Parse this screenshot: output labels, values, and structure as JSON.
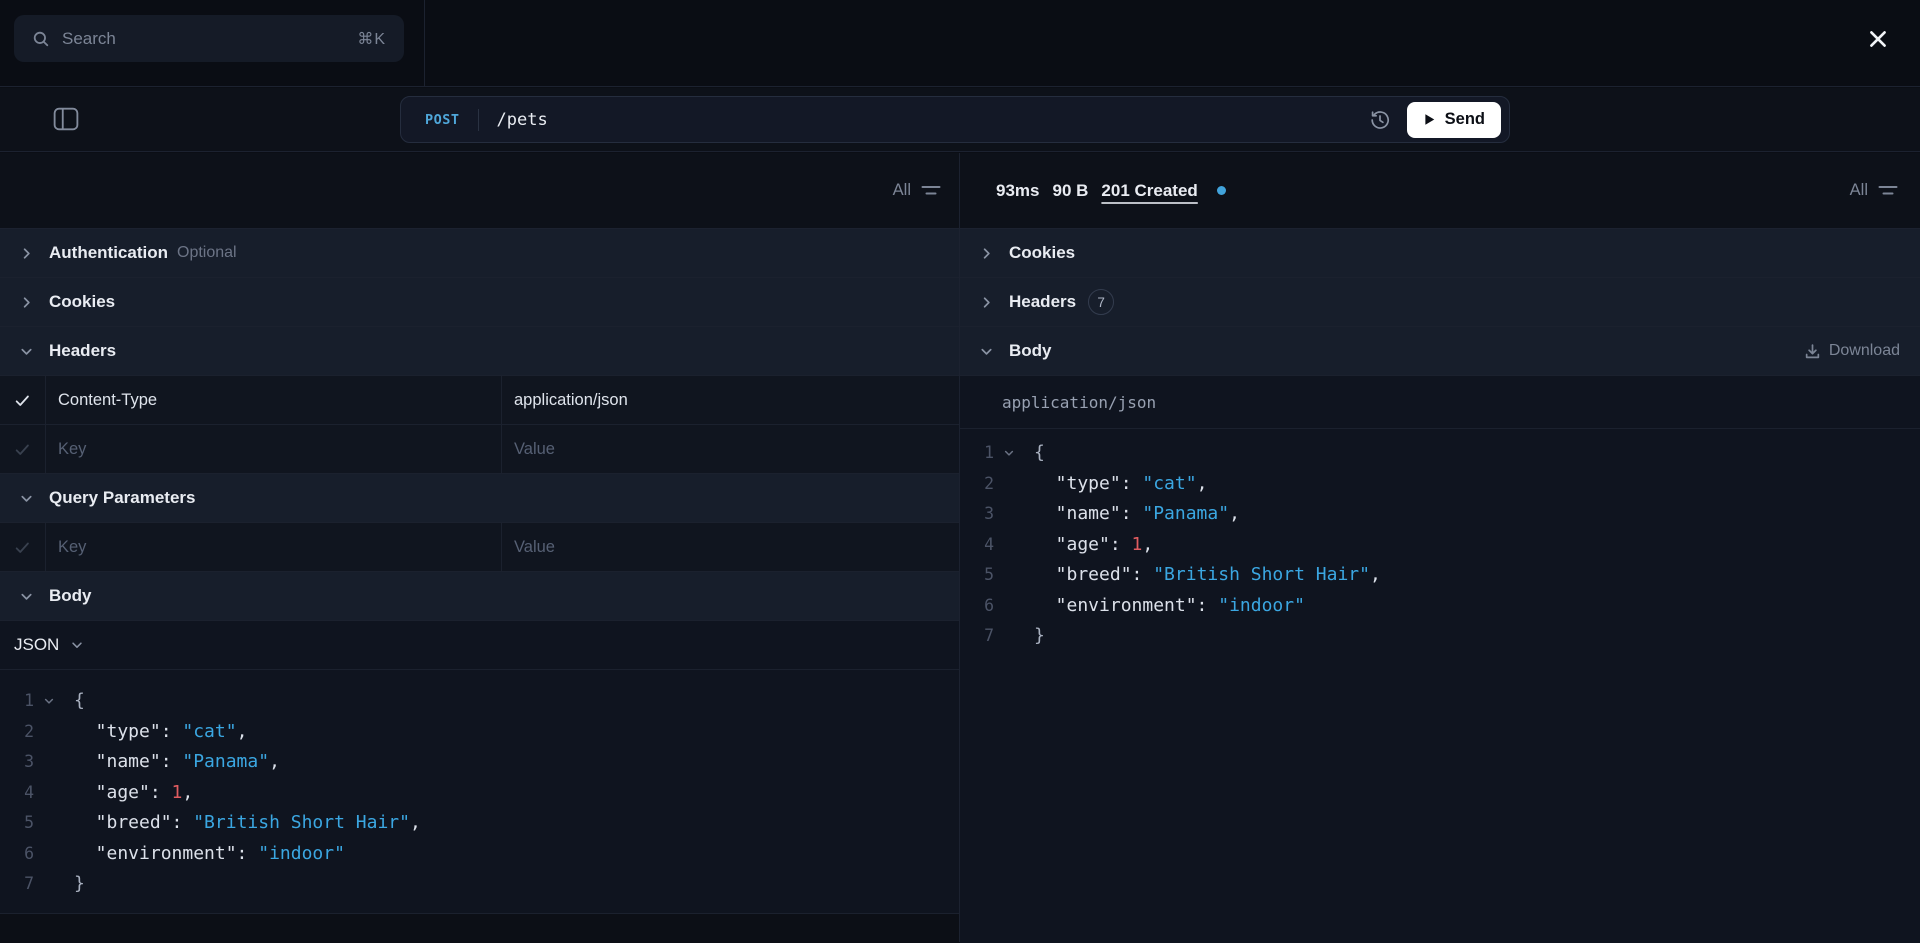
{
  "topbar": {
    "search_placeholder": "Search",
    "search_shortcut": "⌘K"
  },
  "request_bar": {
    "method": "POST",
    "path": "/pets",
    "send_label": "Send"
  },
  "request_panel": {
    "filter_label": "All",
    "auth": {
      "label": "Authentication",
      "hint": "Optional"
    },
    "cookies": {
      "label": "Cookies"
    },
    "headers": {
      "label": "Headers",
      "row": {
        "key": "Content-Type",
        "value": "application/json"
      },
      "empty_row": {
        "key_placeholder": "Key",
        "value_placeholder": "Value"
      }
    },
    "query_params": {
      "label": "Query Parameters",
      "empty_row": {
        "key_placeholder": "Key",
        "value_placeholder": "Value"
      }
    },
    "body": {
      "label": "Body",
      "format_label": "JSON"
    }
  },
  "response_panel": {
    "filter_label": "All",
    "meta": {
      "duration": "93ms",
      "size": "90 B",
      "status": "201 Created"
    },
    "cookies": {
      "label": "Cookies"
    },
    "headers": {
      "label": "Headers",
      "count": "7"
    },
    "body": {
      "label": "Body",
      "download_label": "Download",
      "content_type": "application/json"
    }
  },
  "code": {
    "lines": [
      {
        "num": "1",
        "fold": true,
        "tokens": [
          {
            "c": "brace",
            "v": "{"
          }
        ]
      },
      {
        "num": "2",
        "tokens": [
          {
            "c": "text",
            "v": "  \"type\": "
          },
          {
            "c": "str",
            "v": "\"cat\""
          },
          {
            "c": "text",
            "v": ","
          }
        ]
      },
      {
        "num": "3",
        "tokens": [
          {
            "c": "text",
            "v": "  \"name\": "
          },
          {
            "c": "str",
            "v": "\"Panama\""
          },
          {
            "c": "text",
            "v": ","
          }
        ]
      },
      {
        "num": "4",
        "tokens": [
          {
            "c": "text",
            "v": "  \"age\": "
          },
          {
            "c": "num",
            "v": "1"
          },
          {
            "c": "text",
            "v": ","
          }
        ]
      },
      {
        "num": "5",
        "tokens": [
          {
            "c": "text",
            "v": "  \"breed\": "
          },
          {
            "c": "str",
            "v": "\"British Short Hair\""
          },
          {
            "c": "text",
            "v": ","
          }
        ]
      },
      {
        "num": "6",
        "tokens": [
          {
            "c": "text",
            "v": "  \"environment\": "
          },
          {
            "c": "str",
            "v": "\"indoor\""
          }
        ]
      },
      {
        "num": "7",
        "tokens": [
          {
            "c": "brace",
            "v": "}"
          }
        ]
      }
    ]
  },
  "colors": {
    "accent_blue": "#3ba7e2",
    "number_red": "#e05c60",
    "status_dot": "#41a3db",
    "send_bg": "#ffffff",
    "method_blue": "#4fa7da"
  }
}
